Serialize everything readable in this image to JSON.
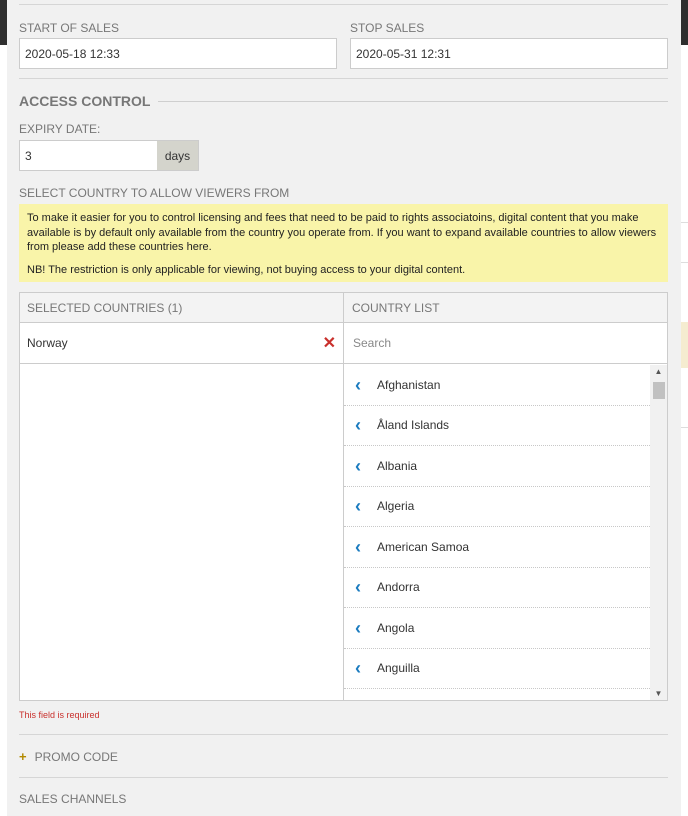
{
  "sales": {
    "start_label": "START OF SALES",
    "start_value": "2020-05-18 12:33",
    "stop_label": "STOP SALES",
    "stop_value": "2020-05-31 12:31"
  },
  "access": {
    "title": "ACCESS CONTROL",
    "expiry_label": "EXPIRY DATE:",
    "expiry_value": "3",
    "expiry_unit": "days",
    "country_label": "SELECT COUNTRY TO ALLOW VIEWERS FROM",
    "notice_1": "To make it easier for you to control licensing and fees that need to be paid to rights associatoins, digital content that you make available is by default only available from the country you operate from. If you want to expand available countries to allow viewers from please add these countries here.",
    "notice_2": "NB! The restriction is only applicable for viewing, not buying access to your digital content."
  },
  "selected": {
    "header": "SELECTED COUNTRIES (1)",
    "items": [
      "Norway"
    ]
  },
  "country_list": {
    "header": "COUNTRY LIST",
    "search_placeholder": "Search",
    "items": [
      "Afghanistan",
      "Åland Islands",
      "Albania",
      "Algeria",
      "American Samoa",
      "Andorra",
      "Angola",
      "Anguilla"
    ]
  },
  "error_text": "This field is required",
  "promo_label": "PROMO CODE",
  "channels_label": "SALES CHANNELS",
  "colors": {
    "accent": "#1a7bbf",
    "error": "#c9302c",
    "notice_bg": "#f9f4a9"
  }
}
